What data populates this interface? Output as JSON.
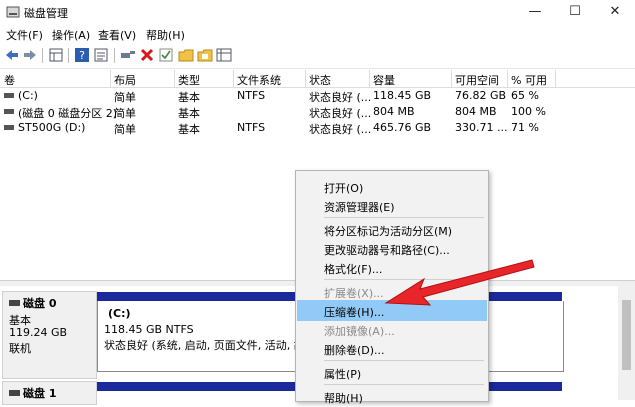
{
  "window": {
    "title": "磁盘管理",
    "minimize_glyph": "—",
    "maximize_glyph": "☐",
    "close_glyph": "✕"
  },
  "menubar": {
    "items": [
      "文件(F)",
      "操作(A)",
      "查看(V)",
      "帮助(H)"
    ]
  },
  "toolbar": {
    "icons": [
      "back-icon",
      "forward-icon",
      "grid-icon",
      "help-icon",
      "properties-icon",
      "connect-icon",
      "delete-icon",
      "check-icon",
      "folder-icon",
      "list-icon"
    ]
  },
  "table": {
    "columns": [
      "卷",
      "布局",
      "类型",
      "文件系统",
      "状态",
      "容量",
      "可用空间",
      "% 可用"
    ],
    "rows": [
      [
        "(C:)",
        "简单",
        "基本",
        "NTFS",
        "状态良好 (...",
        "118.45 GB",
        "76.82 GB",
        "65 %"
      ],
      [
        "(磁盘 0 磁盘分区 2)",
        "简单",
        "基本",
        "",
        "状态良好 (...",
        "804 MB",
        "804 MB",
        "100 %"
      ],
      [
        "ST500G (D:)",
        "简单",
        "基本",
        "NTFS",
        "状态良好 (...",
        "465.76 GB",
        "330.71 ...",
        "71 %"
      ]
    ]
  },
  "disks": [
    {
      "name": "磁盘 0",
      "type": "基本",
      "size": "119.24 GB",
      "status": "联机",
      "partition": {
        "label": "(C:)",
        "size_fs": "118.45 GB NTFS",
        "status": "状态良好 (系统, 启动, 页面文件, 活动, 故障转"
      }
    },
    {
      "name": "磁盘 1"
    }
  ],
  "context_menu": {
    "items": [
      {
        "label": "打开(O)",
        "disabled": false
      },
      {
        "label": "资源管理器(E)",
        "disabled": false
      },
      {
        "label": "将分区标记为活动分区(M)",
        "disabled": false
      },
      {
        "label": "更改驱动器号和路径(C)...",
        "disabled": false
      },
      {
        "label": "格式化(F)...",
        "disabled": false
      },
      {
        "label": "扩展卷(X)...",
        "disabled": true
      },
      {
        "label": "压缩卷(H)...",
        "disabled": false,
        "highlighted": true
      },
      {
        "label": "添加镜像(A)...",
        "disabled": true
      },
      {
        "label": "删除卷(D)...",
        "disabled": false
      },
      {
        "label": "属性(P)",
        "disabled": false
      },
      {
        "label": "帮助(H)",
        "disabled": false
      }
    ]
  },
  "colors": {
    "accent_arrow": "#e8262a",
    "menu_highlight": "#91c9f7",
    "partition_header": "#1a2a9a"
  }
}
